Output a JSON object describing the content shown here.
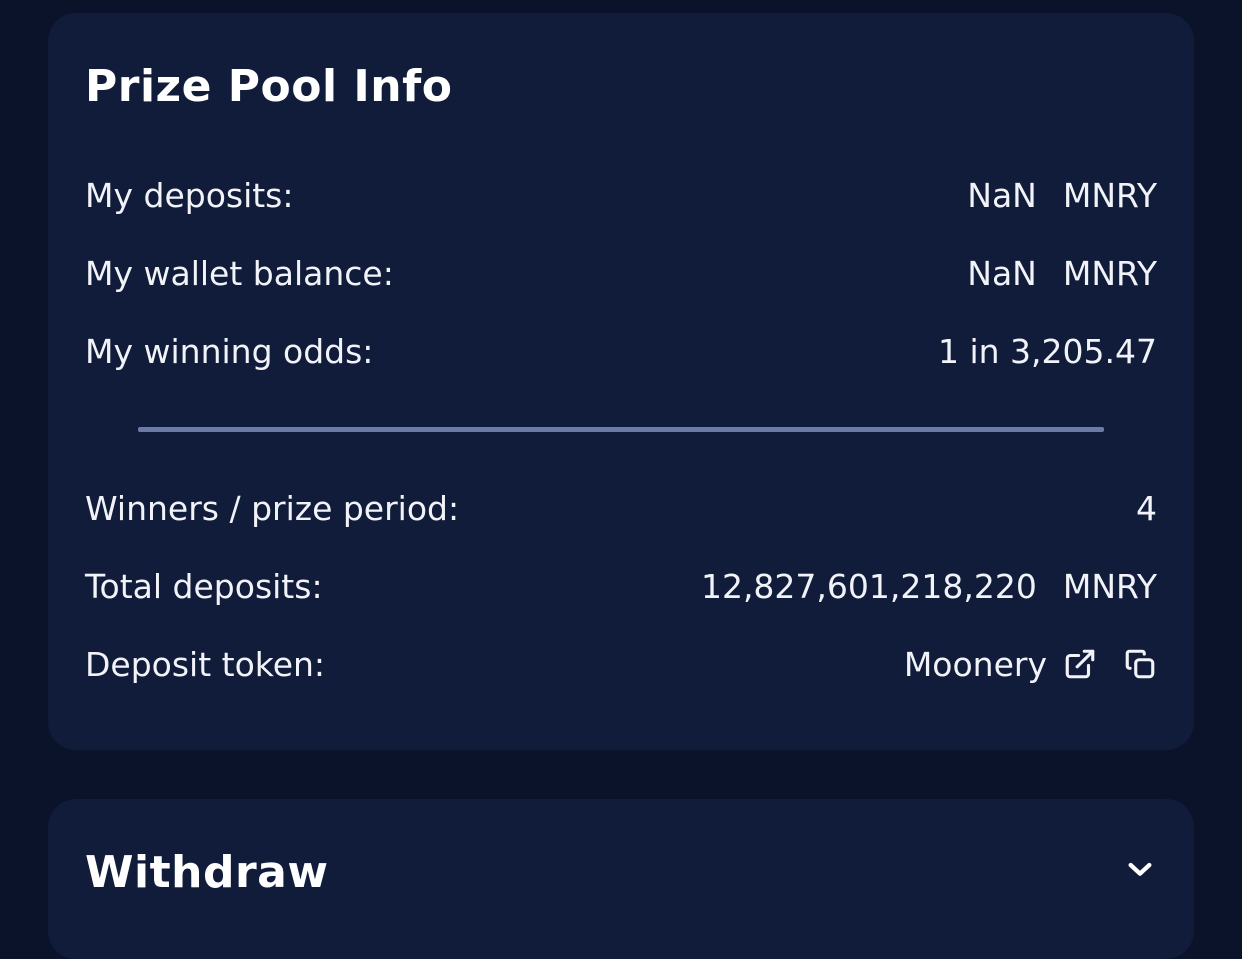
{
  "prize_pool": {
    "title": "Prize Pool Info",
    "my_deposits": {
      "label": "My deposits:",
      "value": "NaN",
      "unit": "MNRY"
    },
    "wallet_balance": {
      "label": "My wallet balance:",
      "value": "NaN",
      "unit": "MNRY"
    },
    "winning_odds": {
      "label": "My winning odds:",
      "value": "1 in 3,205.47"
    },
    "winners_per_period": {
      "label": "Winners / prize period:",
      "value": "4"
    },
    "total_deposits": {
      "label": "Total deposits:",
      "value": "12,827,601,218,220",
      "unit": "MNRY"
    },
    "deposit_token": {
      "label": "Deposit token:",
      "value": "Moonery",
      "link_icon": "external-link-icon",
      "copy_icon": "copy-icon"
    }
  },
  "withdraw": {
    "title": "Withdraw",
    "toggle_icon": "chevron-down-icon"
  },
  "colors": {
    "page_background": "#0b132b",
    "card_background": "#101c3a",
    "divider": "#6c7aa4",
    "text": "#f1f3f8"
  }
}
